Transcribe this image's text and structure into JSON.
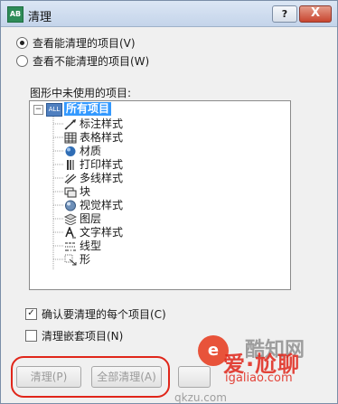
{
  "window": {
    "title": "清理",
    "app_icon_text": "AB",
    "help_label": "?",
    "close_label": "X"
  },
  "options": {
    "view_purgeable": "查看能清理的项目(V)",
    "view_non_purgeable": "查看不能清理的项目(W)",
    "selected": "view_purgeable"
  },
  "tree": {
    "group_label": "图形中未使用的项目:",
    "root_toggle": "−",
    "root_icon_text": "ALL",
    "root_label": "所有项目",
    "items": [
      {
        "label": "标注样式",
        "icon": "dimension-style-icon"
      },
      {
        "label": "表格样式",
        "icon": "table-style-icon"
      },
      {
        "label": "材质",
        "icon": "material-icon"
      },
      {
        "label": "打印样式",
        "icon": "plot-style-icon"
      },
      {
        "label": "多线样式",
        "icon": "multiline-style-icon"
      },
      {
        "label": "块",
        "icon": "block-icon"
      },
      {
        "label": "视觉样式",
        "icon": "visual-style-icon"
      },
      {
        "label": "图层",
        "icon": "layer-icon"
      },
      {
        "label": "文字样式",
        "icon": "text-style-icon"
      },
      {
        "label": "线型",
        "icon": "linetype-icon"
      },
      {
        "label": "形",
        "icon": "shape-icon"
      }
    ]
  },
  "checkboxes": {
    "confirm_each": {
      "label": "确认要清理的每个项目(C)",
      "checked": true
    },
    "purge_nested": {
      "label": "清理嵌套项目(N)",
      "checked": false
    }
  },
  "buttons": {
    "purge": "清理(P)",
    "purge_all": "全部清理(A)"
  },
  "watermark": {
    "logo_text": "e",
    "text_grey": "酷知网",
    "text_red": "爱·尬聊",
    "url_red": "igaliao.com",
    "url_grey": "qkzu.com"
  },
  "colors": {
    "selection": "#3399ff",
    "highlight": "#e0261a"
  }
}
